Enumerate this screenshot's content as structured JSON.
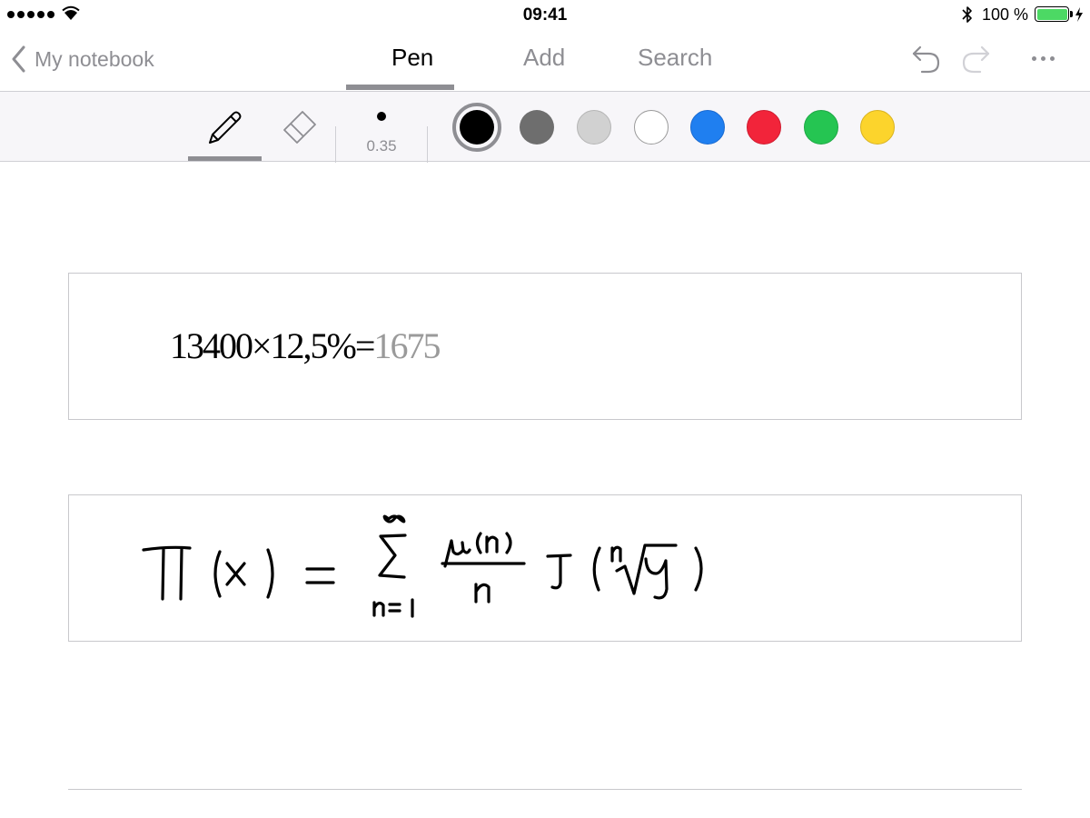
{
  "status": {
    "time": "09:41",
    "battery_percent": "100 %"
  },
  "nav": {
    "back_label": "My notebook",
    "tabs": [
      {
        "label": "Pen",
        "active": true
      },
      {
        "label": "Add",
        "active": false
      },
      {
        "label": "Search",
        "active": false
      }
    ]
  },
  "toolbar": {
    "stroke_width": "0.35",
    "selected_tool": "pen",
    "colors": [
      "#000000",
      "#6e6e6e",
      "#d1d1d1",
      "#ffffff",
      "#1f7ff0",
      "#f2243a",
      "#25c552",
      "#fcd42c"
    ],
    "selected_color": "#000000"
  },
  "content": {
    "calculation": {
      "expression": "13400×12,5%=",
      "result": "1675"
    },
    "handwritten_formula_name": "prime-counting-formula"
  }
}
